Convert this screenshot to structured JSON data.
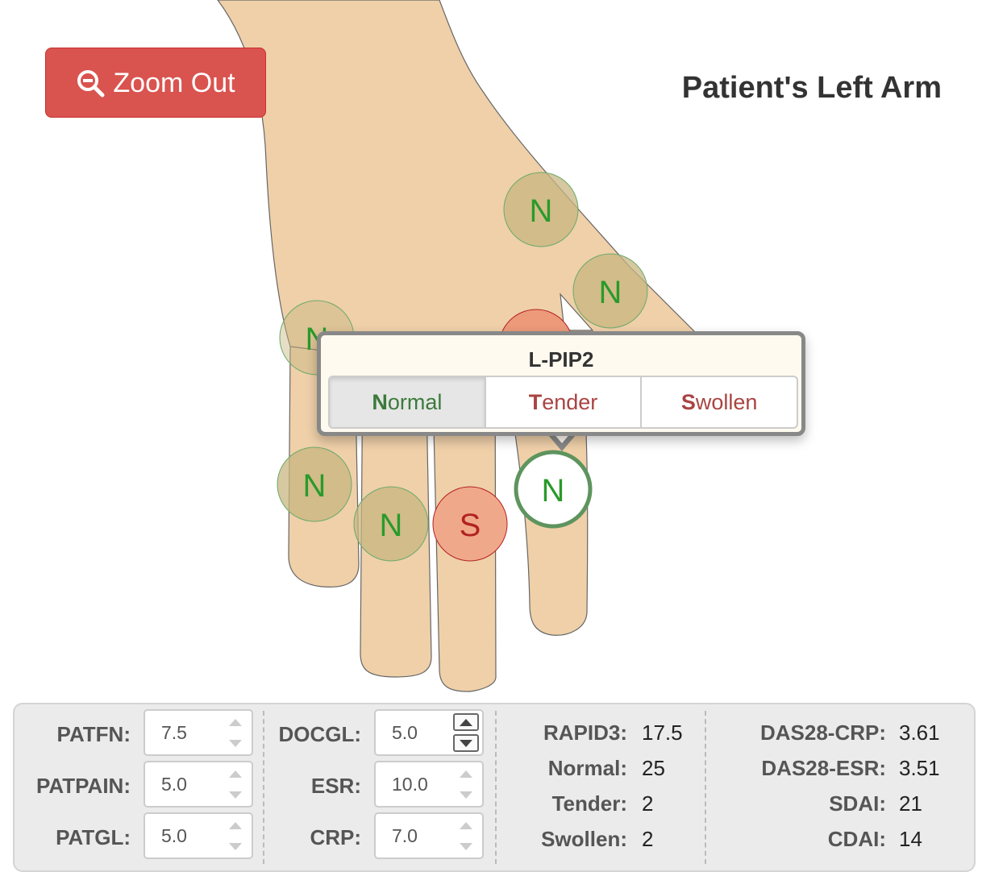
{
  "toolbar": {
    "zoom_label": "Zoom Out"
  },
  "page_title": "Patient's Left Arm",
  "joints": [
    {
      "status": "N",
      "color": "#2a9a2a"
    },
    {
      "status": "N",
      "color": "#2a9a2a"
    },
    {
      "status": "N",
      "color": "#2a9a2a"
    },
    {
      "status": "S",
      "color": "#b22222"
    },
    {
      "status": "N",
      "color": "#2a9a2a"
    },
    {
      "status": "N",
      "color": "#2a9a2a"
    },
    {
      "status": "S",
      "color": "#b22222"
    },
    {
      "status": "N",
      "color": "#2a9a2a",
      "selected": true
    }
  ],
  "popover": {
    "title": "L-PIP2",
    "options": [
      {
        "first": "N",
        "rest": "ormal",
        "active": true
      },
      {
        "first": "T",
        "rest": "ender",
        "active": false
      },
      {
        "first": "S",
        "rest": "wollen",
        "active": false
      }
    ]
  },
  "inputs": {
    "patfn": {
      "label": "PATFN:",
      "value": "7.5"
    },
    "patpain": {
      "label": "PATPAIN:",
      "value": "5.0"
    },
    "patgl": {
      "label": "PATGL:",
      "value": "5.0"
    },
    "docgl": {
      "label": "DOCGL:",
      "value": "5.0"
    },
    "esr": {
      "label": "ESR:",
      "value": "10.0"
    },
    "crp": {
      "label": "CRP:",
      "value": "7.0"
    }
  },
  "counts": {
    "rapid3": {
      "label": "RAPID3:",
      "value": "17.5"
    },
    "normal": {
      "label": "Normal:",
      "value": "25"
    },
    "tender": {
      "label": "Tender:",
      "value": "2"
    },
    "swollen": {
      "label": "Swollen:",
      "value": "2"
    }
  },
  "scores": {
    "das28crp": {
      "label": "DAS28-CRP:",
      "value": "3.61"
    },
    "das28esr": {
      "label": "DAS28-ESR:",
      "value": "3.51"
    },
    "sdai": {
      "label": "SDAI:",
      "value": "21"
    },
    "cdai": {
      "label": "CDAI:",
      "value": "14"
    }
  }
}
